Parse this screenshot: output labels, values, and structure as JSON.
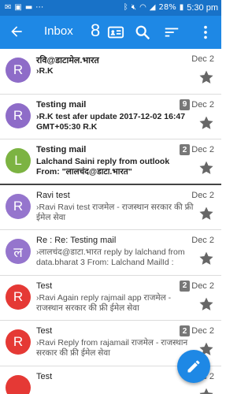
{
  "status_bar": {
    "battery": "28%",
    "time": "5:30 pm"
  },
  "toolbar": {
    "title": "Inbox",
    "unread_count": "8"
  },
  "colors": {
    "toolbar": "#1e88e5",
    "status_bar": "#1872c8",
    "avatar_purple": "#8e6cc8",
    "avatar_green": "#7cb342",
    "avatar_red": "#e53935"
  },
  "messages": [
    {
      "avatar_letter": "R",
      "avatar_color": "#8e6cc8",
      "sender": "रवि@डाटामेल.भारत",
      "preview": "›R.K",
      "date": "Dec 2",
      "count": "",
      "unread": true
    },
    {
      "avatar_letter": "R",
      "avatar_color": "#8e6cc8",
      "sender": "Testing mail",
      "preview": "›R.K test afer update 2017-12-02 16:47 GMT+05:30 R.K",
      "date": "Dec 2",
      "count": "9",
      "unread": true
    },
    {
      "avatar_letter": "L",
      "avatar_color": "#7cb342",
      "sender": "Testing mail",
      "preview": "Lalchand Saini reply from outlook From: \"लालचंद@डाटा.भारत\"",
      "date": "Dec 2",
      "count": "2",
      "unread": true
    },
    {
      "avatar_letter": "R",
      "avatar_color": "#9575cd",
      "sender": "Ravi test",
      "preview": "›Ravi Ravi test राजमेल - राजस्थान सरकार की फ्री ईमेल सेवा",
      "date": "Dec 2",
      "count": "",
      "unread": false
    },
    {
      "avatar_letter": "ल",
      "avatar_color": "#9575cd",
      "sender": "Re : Re: Testing mail",
      "preview": "›लालचंद@डाटा.भारत reply by lalchand from data.bharat 3 From: Lalchand MailId :",
      "date": "Dec 2",
      "count": "",
      "unread": false
    },
    {
      "avatar_letter": "R",
      "avatar_color": "#e53935",
      "sender": "Test",
      "preview": "›Ravi Again reply rajmail app राजमेल - राजस्थान सरकार की फ्री ईमेल सेवा",
      "date": "Dec 2",
      "count": "2",
      "unread": false
    },
    {
      "avatar_letter": "R",
      "avatar_color": "#e53935",
      "sender": "Test",
      "preview": "›Ravi Reply from rajamail राजमेल - राजस्थान सरकार की फ्री ईमेल सेवा",
      "date": "Dec 2",
      "count": "2",
      "unread": false
    },
    {
      "avatar_letter": "",
      "avatar_color": "#e53935",
      "sender": "Test",
      "preview": "",
      "date": "Dec 2",
      "count": "",
      "unread": false
    }
  ]
}
